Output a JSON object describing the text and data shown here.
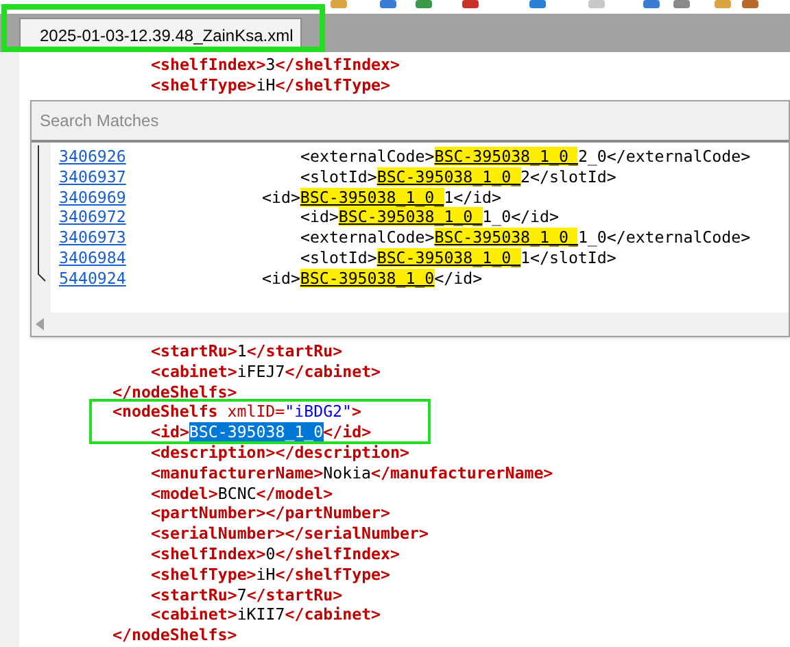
{
  "tab": {
    "title": "2025-01-03-12.39.48_ZainKsa.xml",
    "selected": true
  },
  "editor": {
    "top_lines": [
      {
        "children": [
          {
            "tokens": [
              {
                "kind": "tag",
                "text": "<shelfIndex>"
              },
              {
                "kind": "text",
                "text": "3"
              },
              {
                "kind": "tag",
                "text": "</shelfIndex>"
              }
            ]
          },
          {
            "tokens": [
              {
                "kind": "tag",
                "text": "<shelfType>"
              },
              {
                "kind": "text",
                "text": "iH"
              },
              {
                "kind": "tag",
                "text": "</shelfType>"
              }
            ]
          }
        ]
      }
    ],
    "lines": [
      {
        "children": [
          {
            "tokens": [
              {
                "kind": "tag",
                "text": "<startRu>"
              },
              {
                "kind": "text",
                "text": "1"
              },
              {
                "kind": "tag",
                "text": "</startRu>"
              }
            ]
          },
          {
            "tokens": [
              {
                "kind": "tag",
                "text": "<cabinet>"
              },
              {
                "kind": "text",
                "text": "iFEJ7"
              },
              {
                "kind": "tag",
                "text": "</cabinet>"
              }
            ]
          }
        ]
      },
      {
        "tokens": [
          {
            "kind": "tag",
            "text": "</nodeShelfs>"
          }
        ]
      },
      {
        "tokens": [
          {
            "kind": "tag",
            "text": "<nodeShelfs "
          },
          {
            "kind": "attr",
            "text": "xmlID="
          },
          {
            "kind": "value",
            "text": "\"iBDG2\""
          },
          {
            "kind": "tag",
            "text": ">"
          }
        ],
        "children": [
          {
            "tokens": [
              {
                "kind": "tag",
                "text": "<id>"
              },
              {
                "kind": "selected",
                "text": "BSC-395038_1_0"
              },
              {
                "kind": "tag",
                "text": "</id>"
              }
            ]
          },
          {
            "tokens": [
              {
                "kind": "tag",
                "text": "<description></description>"
              }
            ]
          },
          {
            "tokens": [
              {
                "kind": "tag",
                "text": "<manufacturerName>"
              },
              {
                "kind": "text",
                "text": "Nokia"
              },
              {
                "kind": "tag",
                "text": "</manufacturerName>"
              }
            ]
          },
          {
            "tokens": [
              {
                "kind": "tag",
                "text": "<model>"
              },
              {
                "kind": "text",
                "text": "BCNC"
              },
              {
                "kind": "tag",
                "text": "</model>"
              }
            ]
          },
          {
            "tokens": [
              {
                "kind": "tag",
                "text": "<partNumber></partNumber>"
              }
            ]
          },
          {
            "tokens": [
              {
                "kind": "tag",
                "text": "<serialNumber></serialNumber>"
              }
            ]
          },
          {
            "tokens": [
              {
                "kind": "tag",
                "text": "<shelfIndex>"
              },
              {
                "kind": "text",
                "text": "0"
              },
              {
                "kind": "tag",
                "text": "</shelfIndex>"
              }
            ]
          },
          {
            "tokens": [
              {
                "kind": "tag",
                "text": "<shelfType>"
              },
              {
                "kind": "text",
                "text": "iH"
              },
              {
                "kind": "tag",
                "text": "</shelfType>"
              }
            ]
          },
          {
            "tokens": [
              {
                "kind": "tag",
                "text": "<startRu>"
              },
              {
                "kind": "text",
                "text": "7"
              },
              {
                "kind": "tag",
                "text": "</startRu>"
              }
            ]
          },
          {
            "tokens": [
              {
                "kind": "tag",
                "text": "<cabinet>"
              },
              {
                "kind": "text",
                "text": "iKII7"
              },
              {
                "kind": "tag",
                "text": "</cabinet>"
              }
            ]
          }
        ]
      },
      {
        "tokens": [
          {
            "kind": "tag",
            "text": "</nodeShelfs>"
          }
        ]
      }
    ]
  },
  "search_panel": {
    "title": "Search Matches",
    "results": [
      {
        "line_number": "3406926",
        "kind": "child",
        "before": "<externalCode>",
        "match": "BSC-395038_1_0_",
        "after": "2_0</externalCode>"
      },
      {
        "line_number": "3406937",
        "kind": "child",
        "before": "<slotId>",
        "match": "BSC-395038_1_0_",
        "after": "2</slotId>"
      },
      {
        "line_number": "3406969",
        "kind": "parent",
        "before": "<id>",
        "match": "BSC-395038_1_0_",
        "after": "1</id>"
      },
      {
        "line_number": "3406972",
        "kind": "child",
        "before": "<id>",
        "match": "BSC-395038_1_0_",
        "after": "1_0</id>"
      },
      {
        "line_number": "3406973",
        "kind": "child",
        "before": "<externalCode>",
        "match": "BSC-395038_1_0_",
        "after": "1_0</externalCode>"
      },
      {
        "line_number": "3406984",
        "kind": "child",
        "before": "<slotId>",
        "match": "BSC-395038_1_0_",
        "after": "1</slotId>"
      },
      {
        "line_number": "5440924",
        "kind": "parent",
        "before": "<id>",
        "match": "BSC-395038_1_0",
        "after": "</id>"
      }
    ]
  }
}
